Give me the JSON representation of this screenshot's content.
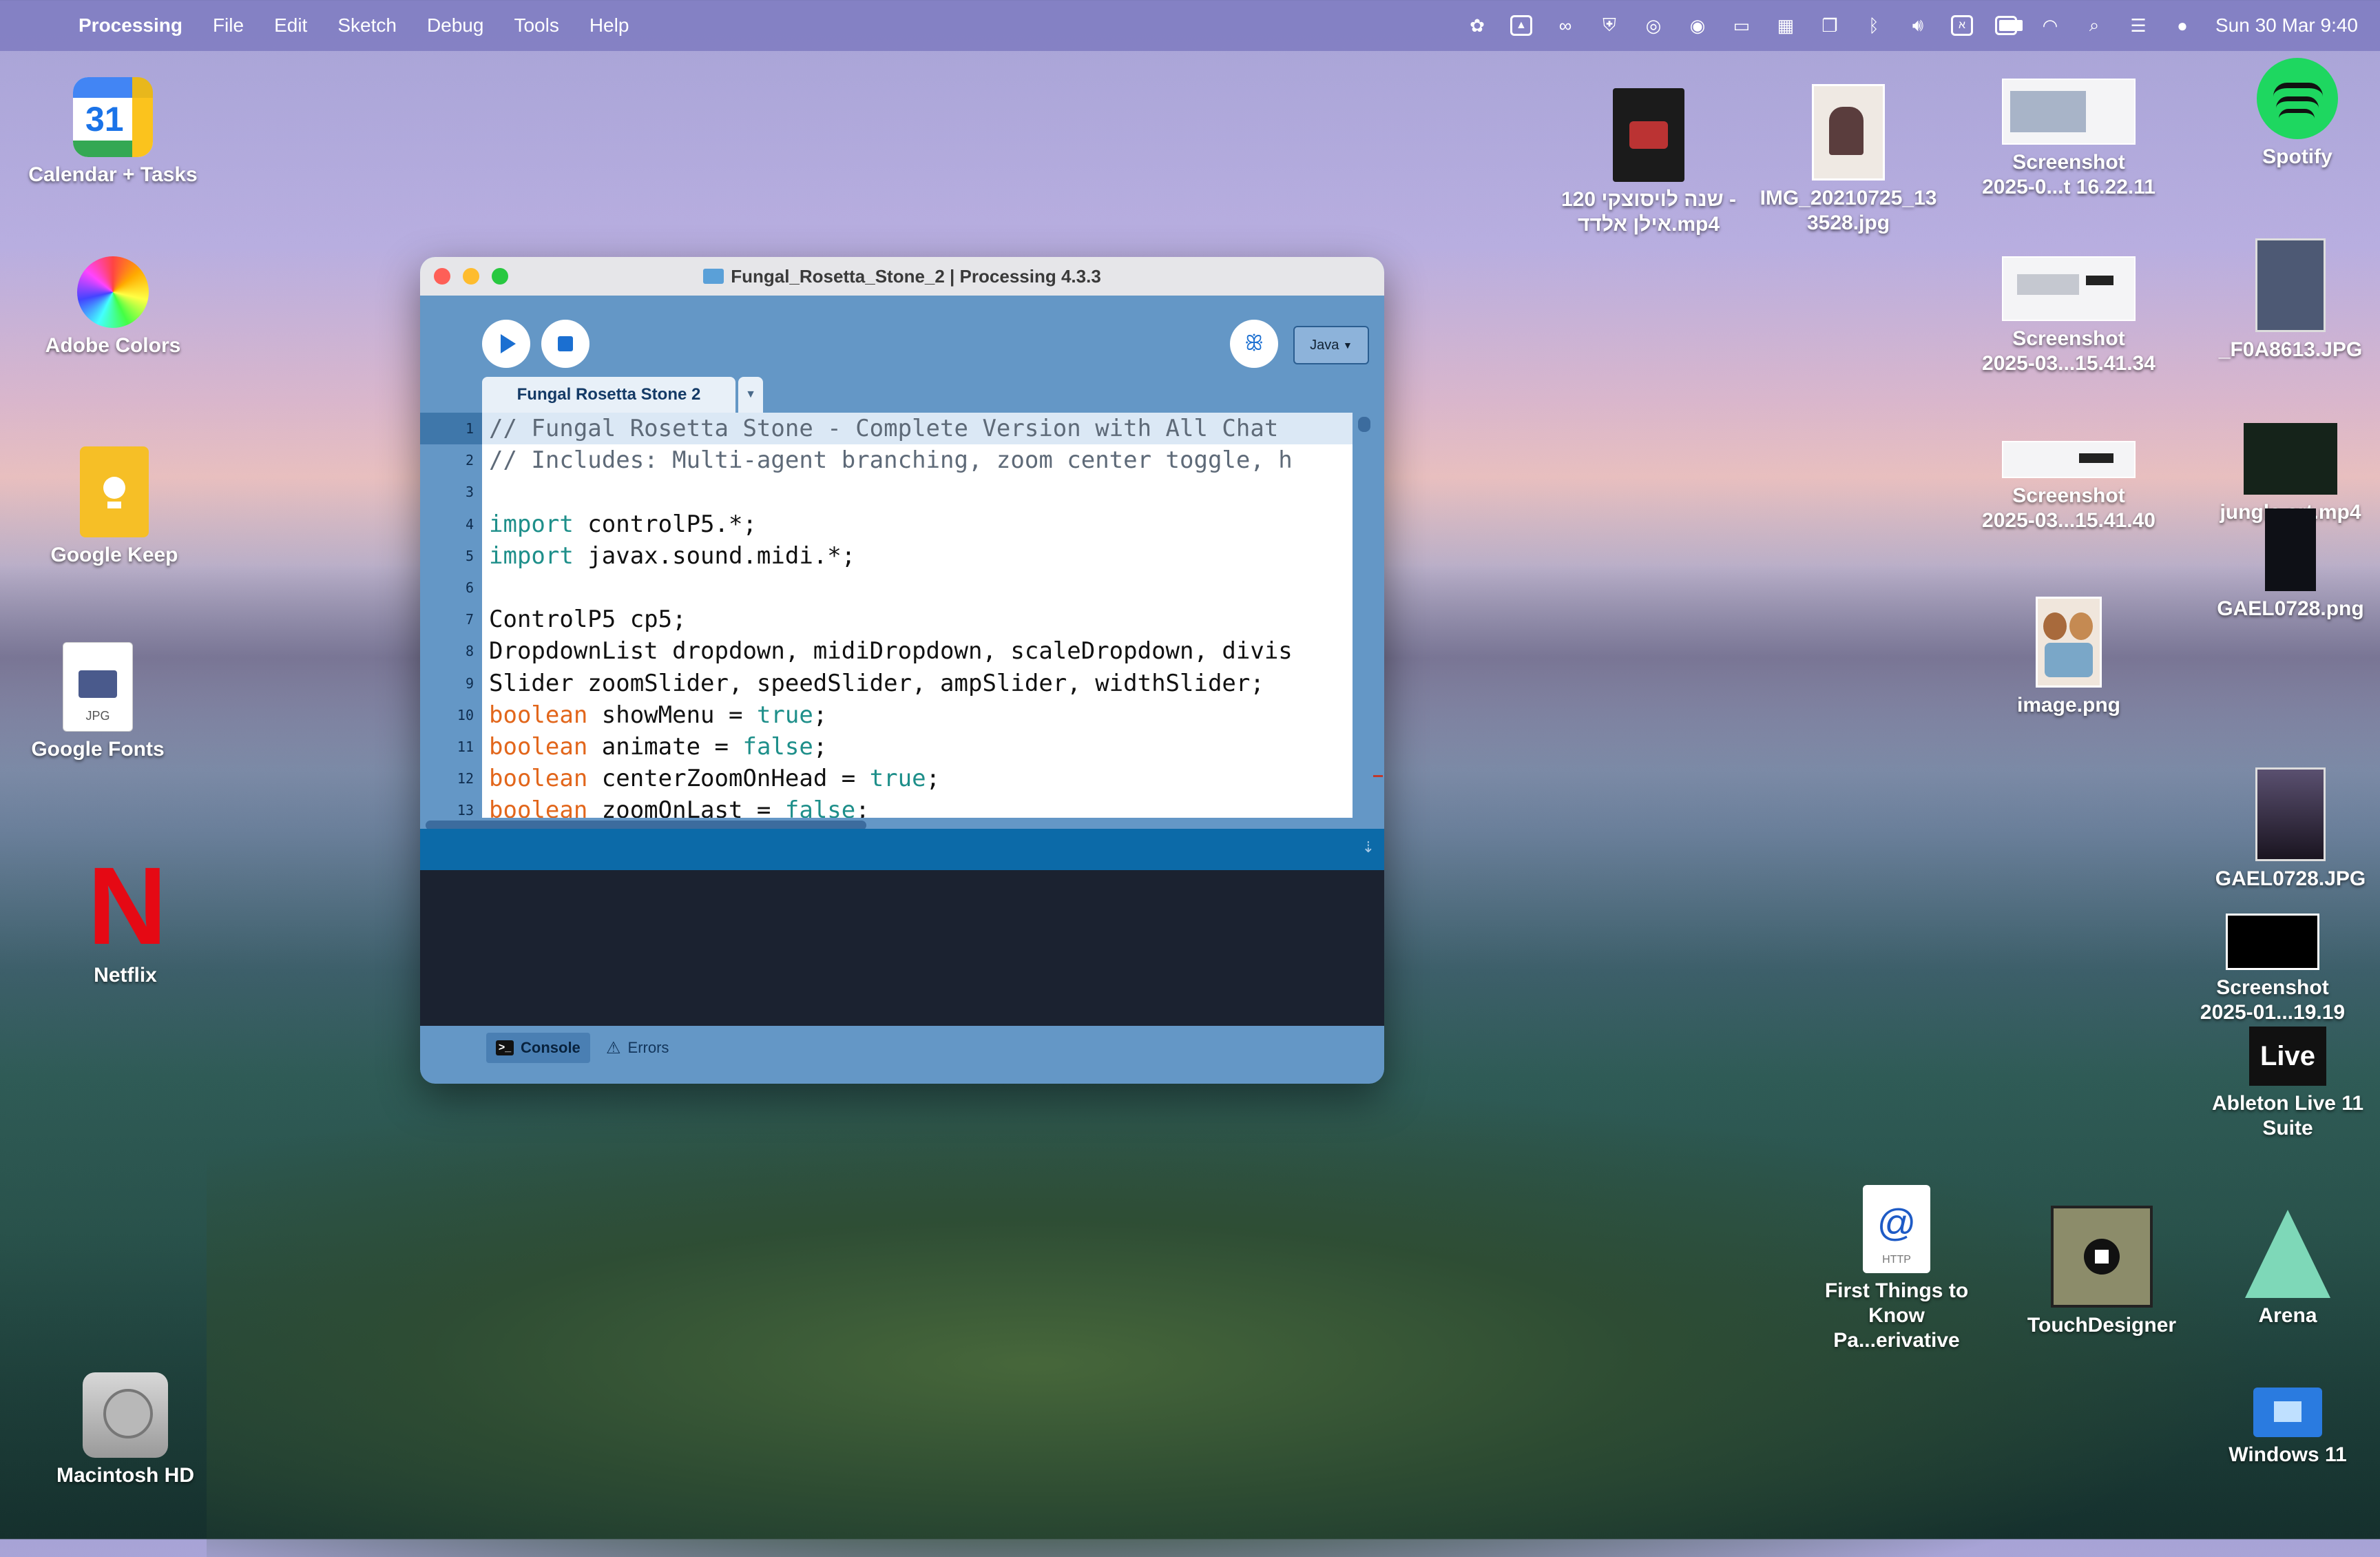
{
  "menubar": {
    "app_name": "Processing",
    "items": [
      "File",
      "Edit",
      "Sketch",
      "Debug",
      "Tools",
      "Help"
    ],
    "clock": "Sun 30 Mar  9:40"
  },
  "desktop_left": [
    {
      "label": "Calendar + Tasks",
      "icon": "calendar-icon",
      "badge": "31"
    },
    {
      "label": "Adobe Colors",
      "icon": "color-wheel-icon"
    },
    {
      "label": "Google Keep",
      "icon": "keep-icon"
    },
    {
      "label": "Google Fonts",
      "icon": "file-icon",
      "badge": "JPG"
    },
    {
      "label": "Netflix",
      "icon": "netflix-icon",
      "badge": "N"
    },
    {
      "label": "Macintosh HD",
      "icon": "hard-drive-icon"
    }
  ],
  "desktop_right": {
    "video1": {
      "line1": "120 שנה לויסוצקי -",
      "line2": "אילן אלדד.mp4"
    },
    "img1": {
      "line1": "IMG_20210725_13",
      "line2": "3528.jpg"
    },
    "screenshot1": {
      "line1": "Screenshot",
      "line2": "2025-0...t 16.22.11"
    },
    "spotify": {
      "label": "Spotify"
    },
    "screenshot2": {
      "line1": "Screenshot",
      "line2": "2025-03...15.41.34"
    },
    "f0a": {
      "label": "_F0A8613.JPG"
    },
    "screenshot3": {
      "line1": "Screenshot",
      "line2": "2025-03...15.41.40"
    },
    "jungle": {
      "label": "jungle crt.mp4"
    },
    "gael_png": {
      "label": "GAEL0728.png"
    },
    "image_png": {
      "label": "image.png"
    },
    "gael_jpg": {
      "label": "GAEL0728.JPG"
    },
    "screenshot4": {
      "line1": "Screenshot",
      "line2": "2025-01...19.19"
    },
    "ableton": {
      "line1": "Ableton Live 11",
      "line2": "Suite",
      "badge": "Live"
    },
    "first_things": {
      "line1": "First Things to",
      "line2": "Know Pa...erivative",
      "badge": "HTTP"
    },
    "touchdesigner": {
      "label": "TouchDesigner"
    },
    "arena": {
      "label": "Arena"
    },
    "windows": {
      "label": "Windows 11"
    }
  },
  "window": {
    "title": "Fungal_Rosetta_Stone_2 | Processing 4.3.3",
    "mode": "Java",
    "mode_arrow": "▼",
    "tab_label": "Fungal Rosetta Stone 2",
    "tab_arrow": "▼",
    "code_lines": [
      {
        "n": "1",
        "parts": [
          [
            "comment",
            "// Fungal Rosetta Stone - Complete Version with All Chat"
          ]
        ]
      },
      {
        "n": "2",
        "parts": [
          [
            "comment",
            "// Includes: Multi-agent branching, zoom center toggle, h"
          ]
        ]
      },
      {
        "n": "3",
        "parts": []
      },
      {
        "n": "4",
        "parts": [
          [
            "kw",
            "import"
          ],
          [
            "plain",
            " controlP5.*;"
          ]
        ]
      },
      {
        "n": "5",
        "parts": [
          [
            "kw",
            "import"
          ],
          [
            "plain",
            " javax.sound.midi.*;"
          ]
        ]
      },
      {
        "n": "6",
        "parts": []
      },
      {
        "n": "7",
        "parts": [
          [
            "plain",
            "ControlP5 cp5;"
          ]
        ]
      },
      {
        "n": "8",
        "parts": [
          [
            "plain",
            "DropdownList dropdown, midiDropdown, scaleDropdown, divis"
          ]
        ]
      },
      {
        "n": "9",
        "parts": [
          [
            "plain",
            "Slider zoomSlider, speedSlider, ampSlider, widthSlider;"
          ]
        ]
      },
      {
        "n": "10",
        "parts": [
          [
            "type",
            "boolean"
          ],
          [
            "plain",
            " showMenu = "
          ],
          [
            "kw",
            "true"
          ],
          [
            "plain",
            ";"
          ]
        ]
      },
      {
        "n": "11",
        "parts": [
          [
            "type",
            "boolean"
          ],
          [
            "plain",
            " animate = "
          ],
          [
            "kw",
            "false"
          ],
          [
            "plain",
            ";"
          ]
        ]
      },
      {
        "n": "12",
        "parts": [
          [
            "type",
            "boolean"
          ],
          [
            "plain",
            " centerZoomOnHead = "
          ],
          [
            "kw",
            "true"
          ],
          [
            "plain",
            ";"
          ]
        ]
      },
      {
        "n": "13",
        "parts": [
          [
            "type",
            "boolean"
          ],
          [
            "plain",
            " zoomOnLast = "
          ],
          [
            "kw",
            "false"
          ],
          [
            "plain",
            ";"
          ]
        ]
      }
    ],
    "console_tab": "Console",
    "errors_tab": "Errors"
  }
}
